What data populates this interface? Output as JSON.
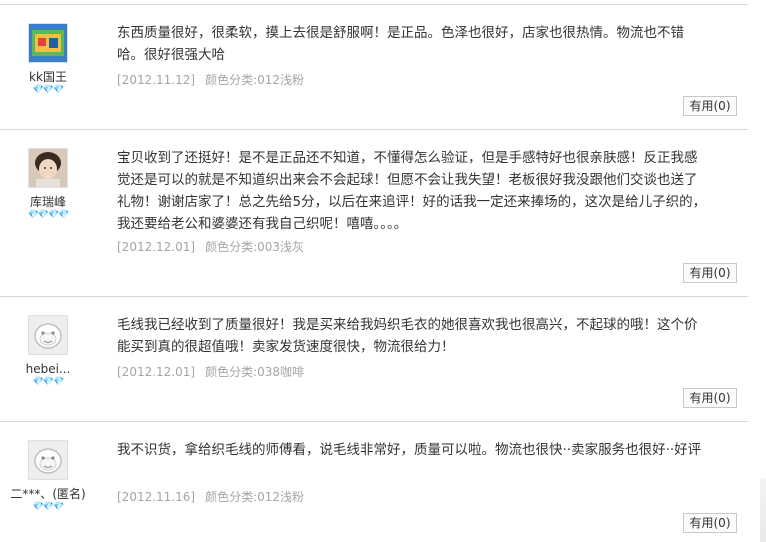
{
  "reviews": [
    {
      "user": "kk国王",
      "hearts": "💎💎💎",
      "content": "东西质量很好，很柔软，摸上去很是舒服啊！是正品。色泽也很好，店家也很热情。物流也不错哈。很好很强大哈",
      "date": "[2012.11.12]",
      "spec": "颜色分类:012浅粉",
      "useful_label": "有用",
      "useful_count": "(0)"
    },
    {
      "user": "库瑞峰",
      "hearts": "💎💎💎💎",
      "content": "宝贝收到了还挺好！是不是正品还不知道，不懂得怎么验证，但是手感特好也很亲肤感！反正我感觉还是可以的就是不知道织出来会不会起球！但愿不会让我失望！老板很好我没跟他们交谈也送了礼物！谢谢店家了！总之先给5分，以后在来追评！好的话我一定还来捧场的，这次是给儿子织的，我还要给老公和婆婆还有我自己织呢！嘻嘻。。。。",
      "date": "[2012.12.01]",
      "spec": "颜色分类:003浅灰",
      "useful_label": "有用",
      "useful_count": "(0)"
    },
    {
      "user": "hebei...",
      "hearts": "💎💎💎",
      "content": "毛线我已经收到了质量很好！我是买来给我妈织毛衣的她很喜欢我也很高兴，不起球的哦！这个价能买到真的很超值哦！卖家发货速度很快，物流很给力！",
      "date": "[2012.12.01]",
      "spec": "颜色分类:038咖啡",
      "useful_label": "有用",
      "useful_count": "(0)"
    },
    {
      "user": "二***、(匿名)",
      "hearts": "💎💎💎",
      "content": "我不识货，拿给织毛线的师傅看，说毛线非常好，质量可以啦。物流也很快··卖家服务也很好··好评",
      "date": "[2012.11.16]",
      "spec": "颜色分类:012浅粉",
      "useful_label": "有用",
      "useful_count": "(0)"
    }
  ]
}
